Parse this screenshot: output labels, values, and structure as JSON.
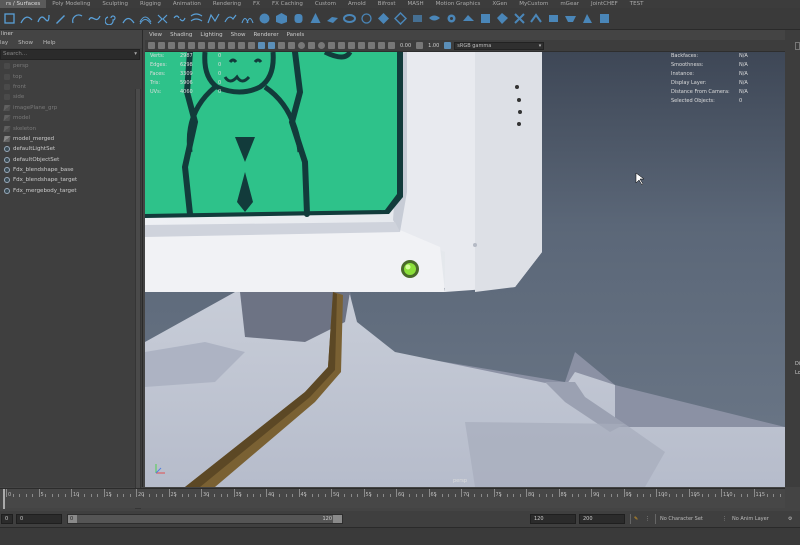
{
  "shelf": {
    "tabs": [
      "Curves / Surfaces",
      "Poly Modeling",
      "Sculpting",
      "Rigging",
      "Animation",
      "Rendering",
      "FX",
      "FX Caching",
      "Custom",
      "Arnold",
      "Bifrost",
      "MASH",
      "Motion Graphics",
      "XGen",
      "MyCustom",
      "mGear",
      "JointCHEF",
      "TEST"
    ],
    "active_tab_visible_text": "rs / Surfaces"
  },
  "outliner": {
    "title": "liner",
    "menu": [
      "lay",
      "Show",
      "Help"
    ],
    "search_placeholder": "Search...",
    "items": [
      {
        "label": "persp",
        "icon": "camera-icon",
        "dim": true
      },
      {
        "label": "top",
        "icon": "camera-icon",
        "dim": true
      },
      {
        "label": "front",
        "icon": "camera-icon",
        "dim": true
      },
      {
        "label": "side",
        "icon": "camera-icon",
        "dim": true
      },
      {
        "label": "imagePlane_grp",
        "icon": "mesh-icon",
        "dim": true
      },
      {
        "label": "model",
        "icon": "mesh-icon",
        "dim": true
      },
      {
        "label": "skeleton",
        "icon": "mesh-icon",
        "dim": true
      },
      {
        "label": "model_merged",
        "icon": "mesh-icon",
        "dim": false
      },
      {
        "label": "defaultLightSet",
        "icon": "set-icon",
        "dim": false
      },
      {
        "label": "defaultObjectSet",
        "icon": "set-icon",
        "dim": false
      },
      {
        "label": "Fdx_blendshape_base",
        "icon": "set-icon",
        "dim": false
      },
      {
        "label": "Fdx_blendshape_target",
        "icon": "set-icon",
        "dim": false
      },
      {
        "label": "Fdx_mergebody_target",
        "icon": "set-icon",
        "dim": false
      }
    ]
  },
  "panel": {
    "menu": [
      "View",
      "Shading",
      "Lighting",
      "Show",
      "Renderer",
      "Panels"
    ],
    "exposure": "0.00",
    "gamma": "1.00",
    "color_space": "sRGB gamma"
  },
  "hud": {
    "left": [
      {
        "k": "Verts:",
        "v": "2987",
        "v2": "0"
      },
      {
        "k": "Edges:",
        "v": "6298",
        "v2": "0"
      },
      {
        "k": "Faces:",
        "v": "3309",
        "v2": "0"
      },
      {
        "k": "Tris:",
        "v": "5906",
        "v2": "0"
      },
      {
        "k": "UVs:",
        "v": "4060",
        "v2": "0"
      }
    ],
    "right": [
      {
        "k": "Backfaces:",
        "v": "N/A"
      },
      {
        "k": "Smoothness:",
        "v": "N/A"
      },
      {
        "k": "Instance:",
        "v": "N/A"
      },
      {
        "k": "Display Layer:",
        "v": "N/A"
      },
      {
        "k": "Distance From Camera:",
        "v": "N/A"
      },
      {
        "k": "Selected Objects:",
        "v": "0"
      }
    ],
    "camera_label": "persp"
  },
  "right_strip": {
    "labels": [
      "Di",
      "Lo"
    ]
  },
  "timeline": {
    "tick_labels": [
      "0",
      "5",
      "10",
      "15",
      "20",
      "25",
      "30",
      "35",
      "40",
      "45",
      "50",
      "55",
      "60",
      "65",
      "70",
      "75",
      "80",
      "85",
      "90",
      "95",
      "100",
      "105",
      "110",
      "115"
    ],
    "current_frame": "0"
  },
  "range": {
    "start_outer": "0",
    "start_inner": "0",
    "range_start_label": "0",
    "range_end_label": "120",
    "end_inner": "120",
    "end_outer": "200",
    "character_set": "No Character Set",
    "anim_layer": "No Anim Layer"
  },
  "colors": {
    "screen_green": "#2ec28a",
    "drawing_outline": "#123b3b",
    "cable": "#7a6133",
    "led": "#8be03a"
  }
}
